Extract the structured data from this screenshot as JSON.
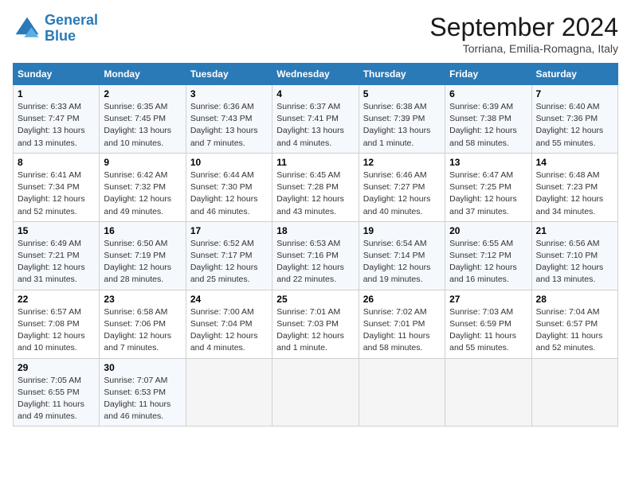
{
  "header": {
    "logo_line1": "General",
    "logo_line2": "Blue",
    "month_year": "September 2024",
    "location": "Torriana, Emilia-Romagna, Italy"
  },
  "days_of_week": [
    "Sunday",
    "Monday",
    "Tuesday",
    "Wednesday",
    "Thursday",
    "Friday",
    "Saturday"
  ],
  "weeks": [
    [
      {
        "day": "1",
        "sunrise": "6:33 AM",
        "sunset": "7:47 PM",
        "daylight": "13 hours and 13 minutes."
      },
      {
        "day": "2",
        "sunrise": "6:35 AM",
        "sunset": "7:45 PM",
        "daylight": "13 hours and 10 minutes."
      },
      {
        "day": "3",
        "sunrise": "6:36 AM",
        "sunset": "7:43 PM",
        "daylight": "13 hours and 7 minutes."
      },
      {
        "day": "4",
        "sunrise": "6:37 AM",
        "sunset": "7:41 PM",
        "daylight": "13 hours and 4 minutes."
      },
      {
        "day": "5",
        "sunrise": "6:38 AM",
        "sunset": "7:39 PM",
        "daylight": "13 hours and 1 minute."
      },
      {
        "day": "6",
        "sunrise": "6:39 AM",
        "sunset": "7:38 PM",
        "daylight": "12 hours and 58 minutes."
      },
      {
        "day": "7",
        "sunrise": "6:40 AM",
        "sunset": "7:36 PM",
        "daylight": "12 hours and 55 minutes."
      }
    ],
    [
      {
        "day": "8",
        "sunrise": "6:41 AM",
        "sunset": "7:34 PM",
        "daylight": "12 hours and 52 minutes."
      },
      {
        "day": "9",
        "sunrise": "6:42 AM",
        "sunset": "7:32 PM",
        "daylight": "12 hours and 49 minutes."
      },
      {
        "day": "10",
        "sunrise": "6:44 AM",
        "sunset": "7:30 PM",
        "daylight": "12 hours and 46 minutes."
      },
      {
        "day": "11",
        "sunrise": "6:45 AM",
        "sunset": "7:28 PM",
        "daylight": "12 hours and 43 minutes."
      },
      {
        "day": "12",
        "sunrise": "6:46 AM",
        "sunset": "7:27 PM",
        "daylight": "12 hours and 40 minutes."
      },
      {
        "day": "13",
        "sunrise": "6:47 AM",
        "sunset": "7:25 PM",
        "daylight": "12 hours and 37 minutes."
      },
      {
        "day": "14",
        "sunrise": "6:48 AM",
        "sunset": "7:23 PM",
        "daylight": "12 hours and 34 minutes."
      }
    ],
    [
      {
        "day": "15",
        "sunrise": "6:49 AM",
        "sunset": "7:21 PM",
        "daylight": "12 hours and 31 minutes."
      },
      {
        "day": "16",
        "sunrise": "6:50 AM",
        "sunset": "7:19 PM",
        "daylight": "12 hours and 28 minutes."
      },
      {
        "day": "17",
        "sunrise": "6:52 AM",
        "sunset": "7:17 PM",
        "daylight": "12 hours and 25 minutes."
      },
      {
        "day": "18",
        "sunrise": "6:53 AM",
        "sunset": "7:16 PM",
        "daylight": "12 hours and 22 minutes."
      },
      {
        "day": "19",
        "sunrise": "6:54 AM",
        "sunset": "7:14 PM",
        "daylight": "12 hours and 19 minutes."
      },
      {
        "day": "20",
        "sunrise": "6:55 AM",
        "sunset": "7:12 PM",
        "daylight": "12 hours and 16 minutes."
      },
      {
        "day": "21",
        "sunrise": "6:56 AM",
        "sunset": "7:10 PM",
        "daylight": "12 hours and 13 minutes."
      }
    ],
    [
      {
        "day": "22",
        "sunrise": "6:57 AM",
        "sunset": "7:08 PM",
        "daylight": "12 hours and 10 minutes."
      },
      {
        "day": "23",
        "sunrise": "6:58 AM",
        "sunset": "7:06 PM",
        "daylight": "12 hours and 7 minutes."
      },
      {
        "day": "24",
        "sunrise": "7:00 AM",
        "sunset": "7:04 PM",
        "daylight": "12 hours and 4 minutes."
      },
      {
        "day": "25",
        "sunrise": "7:01 AM",
        "sunset": "7:03 PM",
        "daylight": "12 hours and 1 minute."
      },
      {
        "day": "26",
        "sunrise": "7:02 AM",
        "sunset": "7:01 PM",
        "daylight": "11 hours and 58 minutes."
      },
      {
        "day": "27",
        "sunrise": "7:03 AM",
        "sunset": "6:59 PM",
        "daylight": "11 hours and 55 minutes."
      },
      {
        "day": "28",
        "sunrise": "7:04 AM",
        "sunset": "6:57 PM",
        "daylight": "11 hours and 52 minutes."
      }
    ],
    [
      {
        "day": "29",
        "sunrise": "7:05 AM",
        "sunset": "6:55 PM",
        "daylight": "11 hours and 49 minutes."
      },
      {
        "day": "30",
        "sunrise": "7:07 AM",
        "sunset": "6:53 PM",
        "daylight": "11 hours and 46 minutes."
      },
      null,
      null,
      null,
      null,
      null
    ]
  ]
}
